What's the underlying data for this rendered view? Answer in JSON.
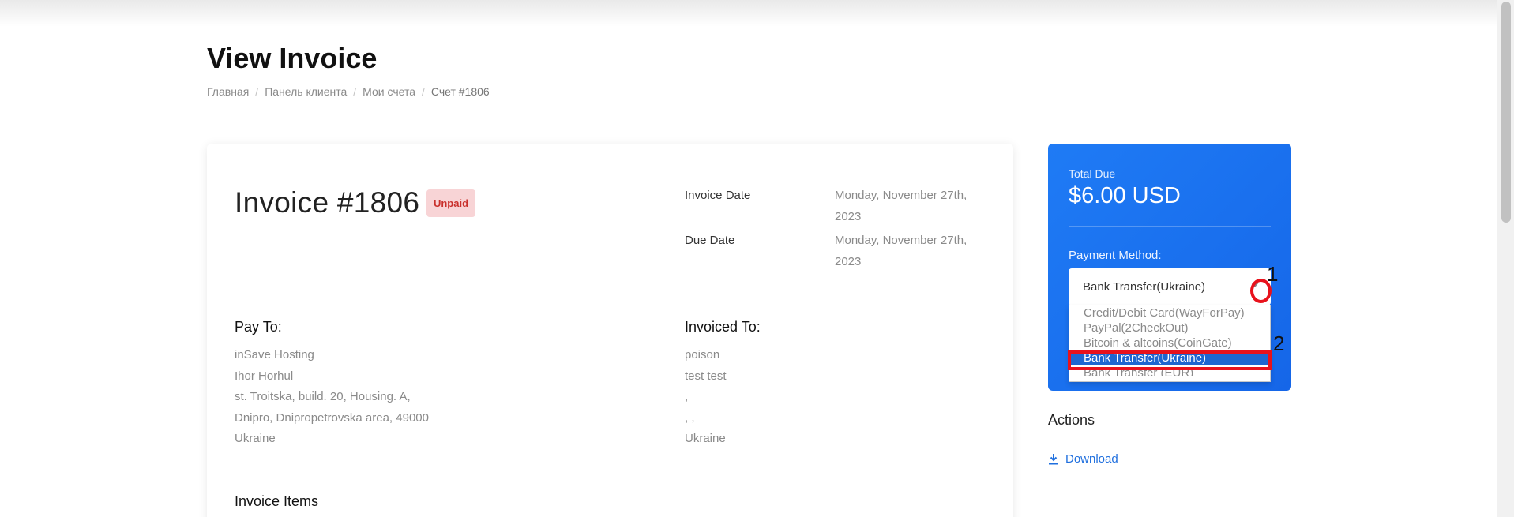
{
  "header": {
    "title": "View Invoice"
  },
  "breadcrumb": [
    "Главная",
    "Панель клиента",
    "Мои счета",
    "Счет #1806"
  ],
  "invoice": {
    "title": "Invoice #1806",
    "status": "Unpaid",
    "invoice_date_label": "Invoice Date",
    "invoice_date_value": "Monday, November 27th, 2023",
    "due_date_label": "Due Date",
    "due_date_value": "Monday, November 27th, 2023",
    "pay_to_label": "Pay To:",
    "pay_to_lines": [
      "inSave Hosting",
      "Ihor Horhul",
      "st. Troitska, build. 20, Housing. A,",
      "Dnipro, Dnipropetrovska area, 49000",
      "Ukraine"
    ],
    "invoiced_to_label": "Invoiced To:",
    "invoiced_to_lines": [
      "poison",
      "test test",
      ",",
      ", ,",
      "Ukraine"
    ],
    "items_label": "Invoice Items"
  },
  "payment": {
    "total_due_label": "Total Due",
    "total_due_value": "$6.00 USD",
    "method_label": "Payment Method:",
    "selected_method": "Bank Transfer(Ukraine)",
    "options": [
      "Credit/Debit Card(WayForPay)",
      "PayPal(2CheckOut)",
      "Bitcoin & altcoins(CoinGate)",
      "Bank Transfer(Ukraine)",
      "Bank Transfer (EUR)"
    ],
    "highlighted_option_index": 3
  },
  "annotations": {
    "marker_1": "1",
    "marker_2": "2"
  },
  "actions": {
    "title": "Actions",
    "download_label": "Download"
  },
  "colors": {
    "accent": "#1f6fde",
    "panel": "#1566e8",
    "unpaid_bg": "#f8d4d6",
    "unpaid_text": "#c9302c",
    "marker_red": "#e8121c"
  }
}
